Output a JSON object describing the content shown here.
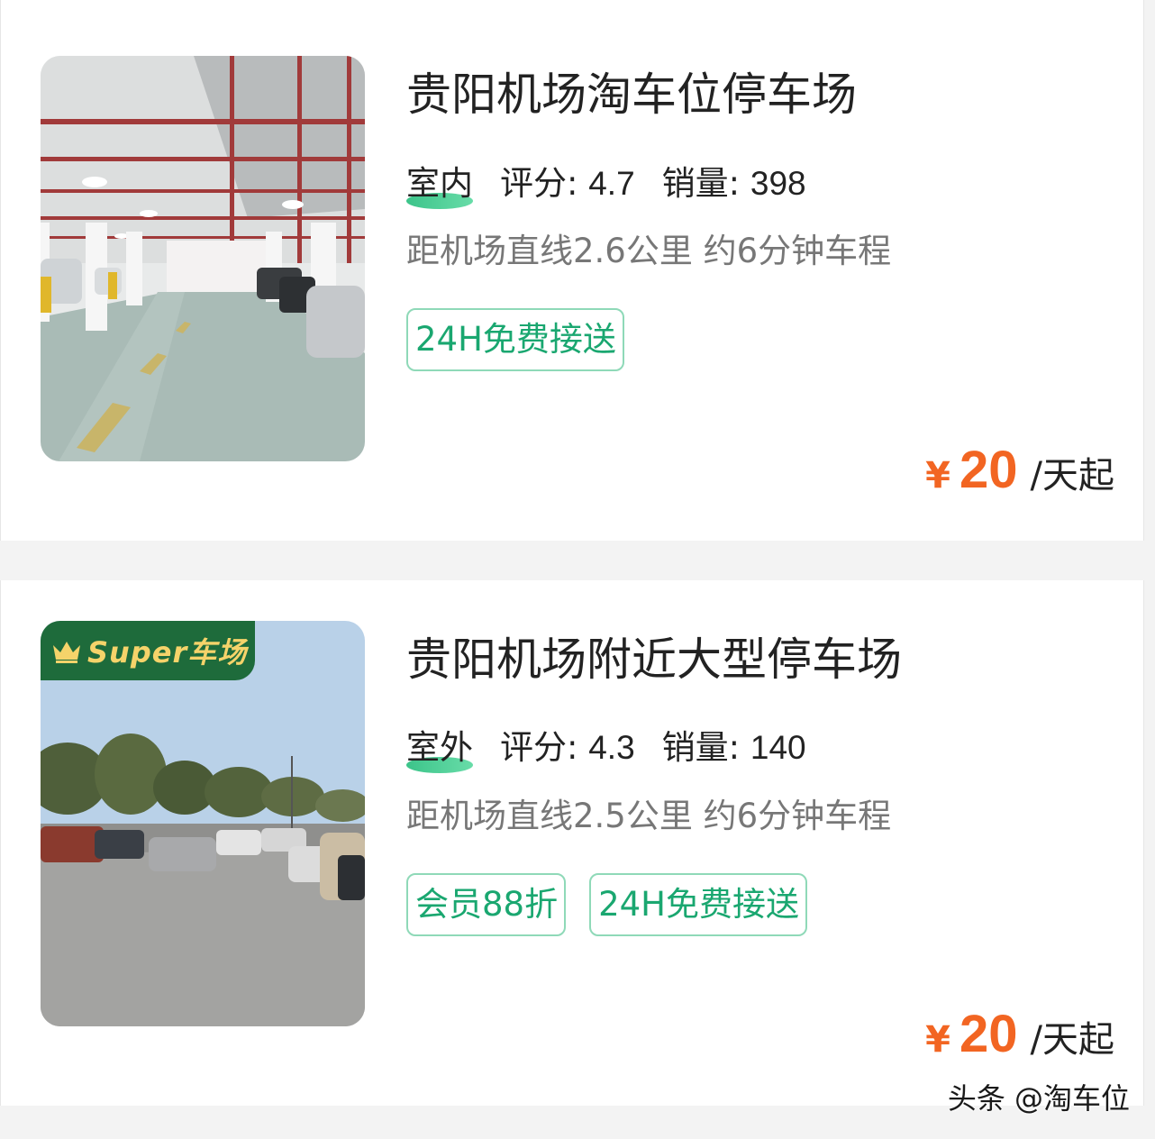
{
  "listings": [
    {
      "title": "贵阳机场淘车位停车场",
      "type": "室内",
      "rating_label": "评分:",
      "rating": "4.7",
      "sales_label": "销量:",
      "sales": "398",
      "distance": "距机场直线2.6公里 约6分钟车程",
      "tags": [
        "24H免费接送"
      ],
      "currency": "¥",
      "price": "20",
      "price_unit": "/天起",
      "image": "indoor-parking-garage-photo"
    },
    {
      "badge": "Super车场",
      "title": "贵阳机场附近大型停车场",
      "type": "室外",
      "rating_label": "评分:",
      "rating": "4.3",
      "sales_label": "销量:",
      "sales": "140",
      "distance": "距机场直线2.5公里 约6分钟车程",
      "tags": [
        "会员88折",
        "24H免费接送"
      ],
      "currency": "¥",
      "price": "20",
      "price_unit": "/天起",
      "image": "outdoor-parking-lot-photo"
    }
  ],
  "watermark": "头条 @淘车位",
  "colors": {
    "price": "#f26522",
    "tag_text": "#1aa770",
    "tag_border": "#8fd9b8",
    "badge_bg": "#1e6b3b",
    "badge_text": "#f5d36a"
  }
}
